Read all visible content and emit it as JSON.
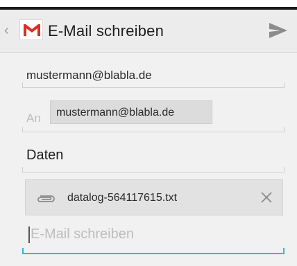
{
  "actionbar": {
    "title": "E-Mail schreiben",
    "app_icon": "gmail-icon",
    "send_icon": "send-icon"
  },
  "compose": {
    "from": "mustermann@blabla.de",
    "to_label": "An",
    "to_chip": "mustermann@blabla.de",
    "subject": "Daten",
    "attachment": {
      "icon": "paperclip-icon",
      "filename": "datalog-564117615.txt",
      "remove_icon": "close-icon"
    },
    "body_placeholder": "E-Mail schreiben"
  },
  "colors": {
    "accent": "#33b5e5",
    "gmail_red": "#d93025"
  }
}
